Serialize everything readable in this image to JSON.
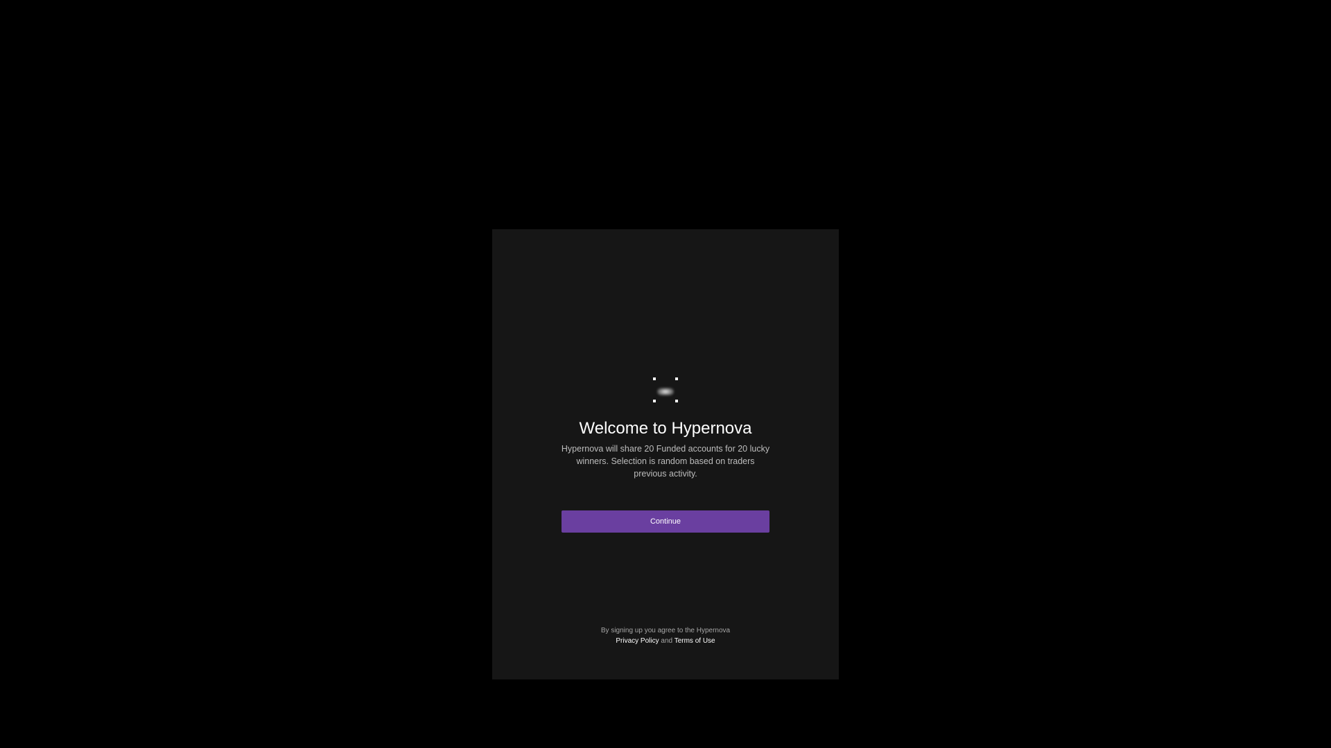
{
  "modal": {
    "title": "Welcome to Hypernova",
    "description": "Hypernova will share 20 Funded accounts for 20 lucky winners. Selection is random based on traders previous activity.",
    "continue_label": "Continue",
    "logo_icon": "hypernova-logo-icon"
  },
  "footer": {
    "agree_text": "By signing up you agree to the Hypernova",
    "privacy_label": "Privacy Policy",
    "and_text": "and",
    "terms_label": "Terms of Use"
  },
  "colors": {
    "background": "#000000",
    "modal_background": "#161616",
    "accent": "#6a3fa0"
  }
}
